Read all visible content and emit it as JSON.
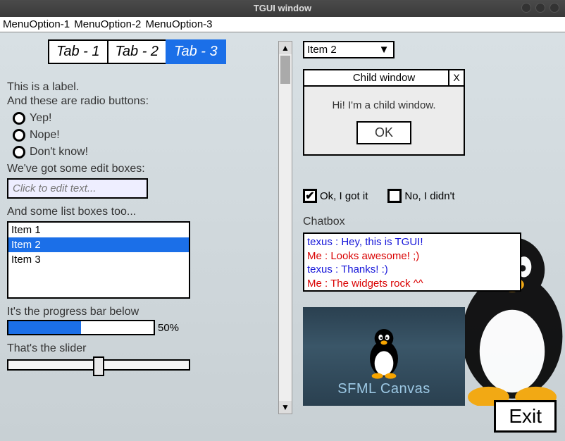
{
  "window": {
    "title": "TGUI window"
  },
  "menubar": [
    "MenuOption-1",
    "MenuOption-2",
    "MenuOption-3"
  ],
  "tabs": {
    "items": [
      "Tab - 1",
      "Tab - 2",
      "Tab - 3"
    ],
    "selected_index": 2
  },
  "labels": {
    "intro1": "This is a label.",
    "intro2": "And these are radio buttons:",
    "editboxes": "We've got some edit boxes:",
    "listboxes": "And some list boxes too...",
    "progress": "It's the progress bar below",
    "slider": "That's the slider",
    "chatbox": "Chatbox"
  },
  "radios": [
    "Yep!",
    "Nope!",
    "Don't know!"
  ],
  "editbox": {
    "placeholder": "Click to edit text..."
  },
  "listbox": {
    "items": [
      "Item 1",
      "Item 2",
      "Item 3"
    ],
    "selected_index": 1
  },
  "progress": {
    "value": 50,
    "text": "50%"
  },
  "combobox": {
    "value": "Item 2"
  },
  "child_window": {
    "title": "Child window",
    "body": "Hi! I'm a child window.",
    "ok": "OK"
  },
  "checkboxes": [
    {
      "label": "Ok, I got it",
      "checked": true
    },
    {
      "label": "No, I didn't",
      "checked": false
    }
  ],
  "chat": [
    {
      "text": "texus : Hey, this is TGUI!",
      "color": "blue"
    },
    {
      "text": "Me : Looks awesome! ;)",
      "color": "red"
    },
    {
      "text": "texus : Thanks! :)",
      "color": "blue"
    },
    {
      "text": "Me : The widgets rock ^^",
      "color": "red"
    }
  ],
  "canvas": {
    "caption": "SFML Canvas"
  },
  "exit": "Exit"
}
